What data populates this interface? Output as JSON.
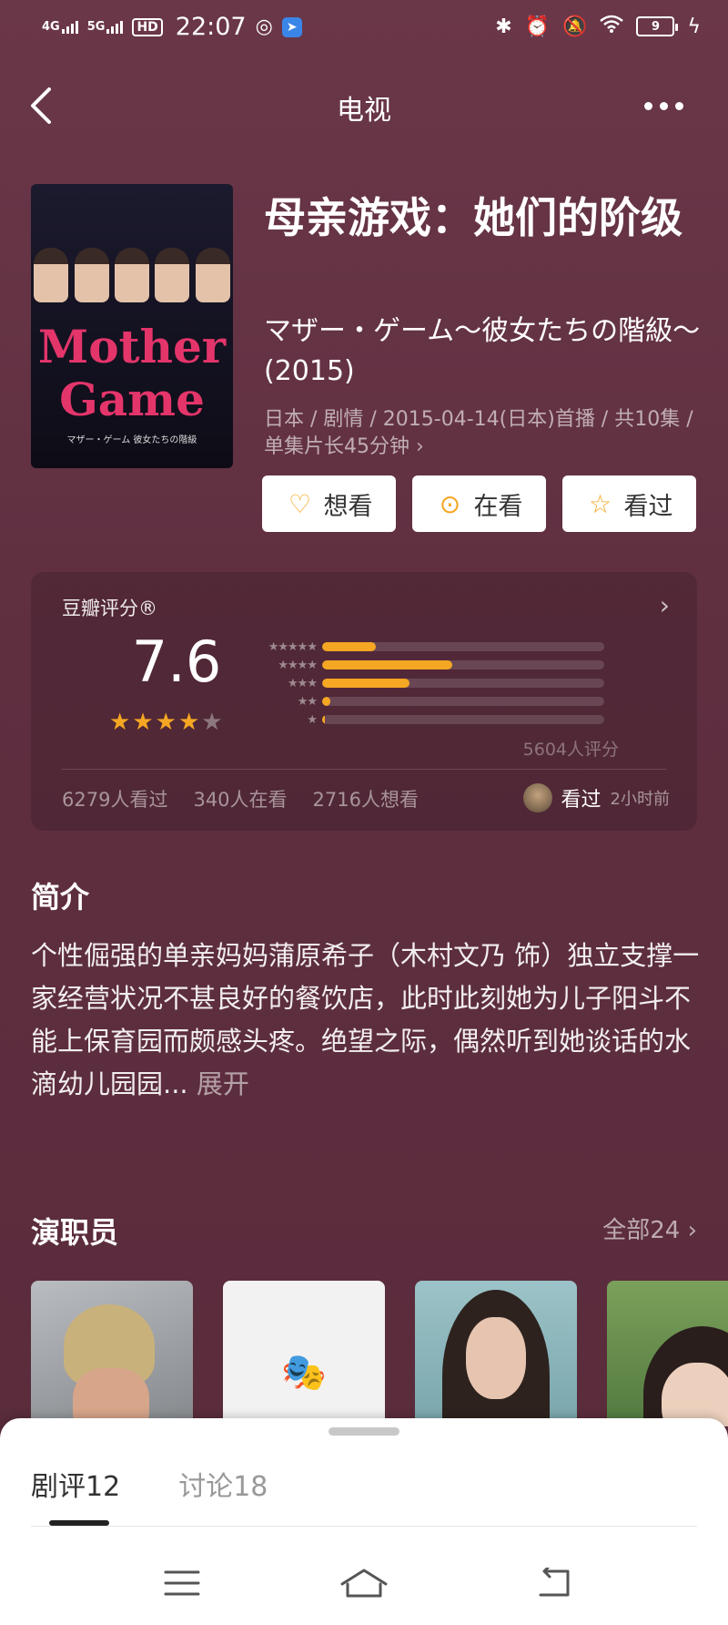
{
  "status_bar": {
    "network_1": "4G",
    "network_2": "5G",
    "hd_badge": "HD",
    "time": "22:07",
    "battery_level": "9",
    "icons": [
      "signal-icon",
      "weibo-icon",
      "app-notification-icon",
      "bluetooth-icon",
      "alarm-icon",
      "mute-icon",
      "wifi-icon",
      "battery-icon",
      "charging-icon"
    ]
  },
  "nav": {
    "title": "电视",
    "back_icon": "chevron-left-icon",
    "more_icon": "more-dots-icon"
  },
  "poster": {
    "title_line1": "Mother",
    "title_line2": "Game",
    "subtitle": "マザー・ゲーム 彼女たちの階級"
  },
  "show": {
    "title": "母亲游戏：她们的阶级",
    "original_title": "マザー・ゲーム～彼女たちの階級～ (2015)",
    "meta": "日本 / 剧情 / 2015-04-14(日本)首播 / 共10集 / 单集片长45分钟 ›"
  },
  "actions": [
    {
      "label": "想看",
      "icon": "heart-plus-icon"
    },
    {
      "label": "在看",
      "icon": "watching-circle-icon"
    },
    {
      "label": "看过",
      "icon": "star-outline-icon"
    }
  ],
  "rating": {
    "label": "豆瓣评分®",
    "score": "7.6",
    "stars": 4,
    "rating_count": "5604人评分",
    "distribution": [
      {
        "label": "★★★★★",
        "fraction": 0.19
      },
      {
        "label": "★★★★",
        "fraction": 0.46
      },
      {
        "label": "★★★",
        "fraction": 0.31
      },
      {
        "label": "★★",
        "fraction": 0.03
      },
      {
        "label": "★",
        "fraction": 0.01
      }
    ],
    "watched": "6279人看过",
    "watching": "340人在看",
    "want": "2716人想看",
    "friend_action": "看过",
    "friend_time": "2小时前"
  },
  "intro": {
    "heading": "简介",
    "text": "个性倔强的单亲妈妈蒲原希子（木村文乃 饰）独立支撑一家经营状况不甚良好的餐饮店，此时此刻她为儿子阳斗不能上保育园而颇感头疼。绝望之际，偶然听到她谈话的水滴幼儿园园...",
    "expand": "展开"
  },
  "cast": {
    "heading": "演职员",
    "all_link": "全部24 ›"
  },
  "sheet": {
    "tabs": [
      {
        "label": "剧评",
        "count": "12"
      },
      {
        "label": "讨论",
        "count": "18"
      }
    ]
  },
  "system_nav": [
    "menu-icon",
    "home-icon",
    "back-icon"
  ],
  "colors": {
    "background": "#5f2f40",
    "accent": "#f5a623",
    "poster_title": "#e4356b"
  }
}
